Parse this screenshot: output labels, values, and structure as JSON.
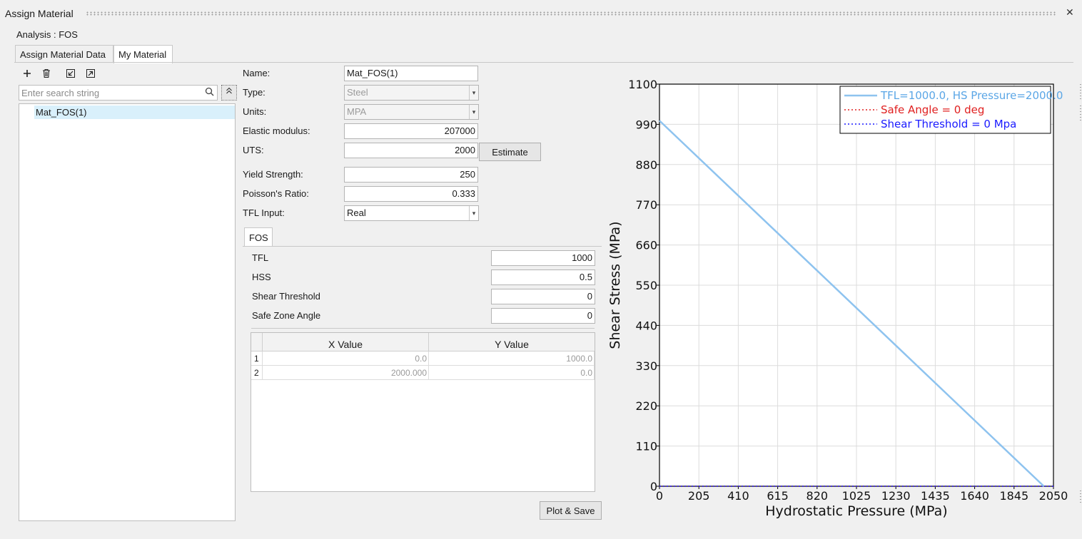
{
  "window": {
    "title": "Assign Material"
  },
  "analysis": {
    "label": "Analysis : FOS"
  },
  "tabs": [
    {
      "label": "Assign Material Data",
      "active": false
    },
    {
      "label": "My Material",
      "active": true
    }
  ],
  "toolbar": {
    "icons": [
      "plus-icon",
      "trash-icon",
      "import-icon",
      "export-icon"
    ]
  },
  "search": {
    "placeholder": "Enter search string"
  },
  "tree": {
    "items": [
      {
        "label": "Mat_FOS(1)",
        "selected": true
      }
    ]
  },
  "form": {
    "name": {
      "label": "Name:",
      "value": "Mat_FOS(1)"
    },
    "type": {
      "label": "Type:",
      "value": "Steel"
    },
    "units": {
      "label": "Units:",
      "value": "MPA"
    },
    "elastic_modulus": {
      "label": "Elastic modulus:",
      "value": "207000"
    },
    "uts": {
      "label": "UTS:",
      "value": "2000"
    },
    "estimate_button": "Estimate",
    "yield_strength": {
      "label": "Yield Strength:",
      "value": "250"
    },
    "poissons_ratio": {
      "label": "Poisson's Ratio:",
      "value": "0.333"
    },
    "tfl_input": {
      "label": "TFL Input:",
      "value": "Real"
    }
  },
  "fos": {
    "tab_label": "FOS",
    "tfl": {
      "label": "TFL",
      "value": "1000"
    },
    "hss": {
      "label": "HSS",
      "value": "0.5"
    },
    "shear_threshold": {
      "label": "Shear Threshold",
      "value": "0"
    },
    "safe_zone_angle": {
      "label": "Safe Zone Angle",
      "value": "0"
    },
    "table": {
      "columns": [
        "X Value",
        "Y Value"
      ],
      "rows": [
        {
          "num": "1",
          "x": "0.0",
          "y": "1000.0"
        },
        {
          "num": "2",
          "x": "2000.000",
          "y": "0.0"
        }
      ]
    },
    "plot_button": "Plot & Save"
  },
  "chart_data": {
    "type": "line",
    "xlabel": "Hydrostatic Pressure (MPa)",
    "ylabel": "Shear Stress (MPa)",
    "xlim": [
      0,
      2050
    ],
    "ylim": [
      0,
      1100
    ],
    "xticks": [
      0,
      205,
      410,
      615,
      820,
      1025,
      1230,
      1435,
      1640,
      1845,
      2050
    ],
    "yticks": [
      0,
      110,
      220,
      330,
      440,
      550,
      660,
      770,
      880,
      990,
      1100
    ],
    "grid": true,
    "legend_position": "top-right",
    "series": [
      {
        "name": "TFL=1000.0, HS Pressure=2000.0",
        "color": "#8ec3ef",
        "style": "solid",
        "x": [
          0,
          2000
        ],
        "y": [
          1000,
          0
        ]
      },
      {
        "name": "Safe Angle = 0 deg",
        "color": "#e02020",
        "style": "dotted",
        "x": [
          0,
          2050
        ],
        "y": [
          0,
          0
        ]
      },
      {
        "name": "Shear Threshold = 0 Mpa",
        "color": "#1a1aff",
        "style": "dotted",
        "x": [
          0,
          2050
        ],
        "y": [
          0,
          0
        ]
      }
    ]
  }
}
